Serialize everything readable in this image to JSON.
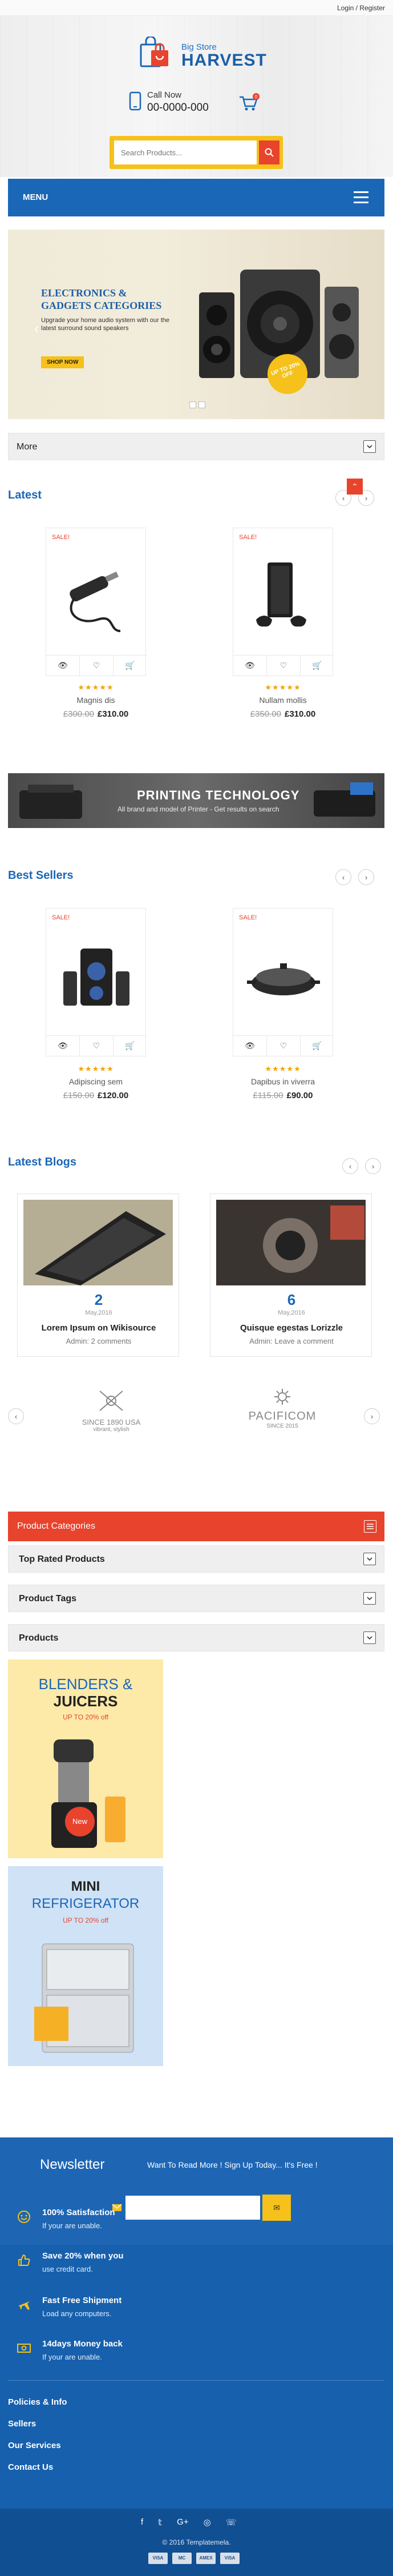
{
  "topbar": {
    "login": "Login / Register"
  },
  "header": {
    "brand_small": "Big Store",
    "brand_big": "HARVEST",
    "call_label": "Call Now",
    "phone": "00-0000-000",
    "cart_count": "0",
    "search_placeholder": "Search Products..."
  },
  "menu": {
    "label": "MENU"
  },
  "slider": {
    "title_line1": "ELECTRONICS &",
    "title_line2": "GADGETS CATEGORIES",
    "text": "Upgrade your home audio system with our the latest surround sound speakers",
    "button": "SHOP NOW",
    "badge": "UP TO 20% OFF"
  },
  "more": {
    "label": "More"
  },
  "latest": {
    "title": "Latest",
    "products": [
      {
        "sale": "SALE!",
        "name": "Magnis dis",
        "old": "£300.00",
        "price": "£310.00",
        "stars": "★★★★★"
      },
      {
        "sale": "SALE!",
        "name": "Nullam mollis",
        "old": "£350.00",
        "price": "£310.00",
        "stars": "★★★★★"
      }
    ]
  },
  "print_banner": {
    "title": "PRINTING TECHNOLOGY",
    "subtitle": "All brand and model of Printer - Get results on search"
  },
  "bestsellers": {
    "title": "Best Sellers",
    "products": [
      {
        "sale": "SALE!",
        "name": "Adipiscing sem",
        "old": "£150.00",
        "price": "£120.00",
        "stars": "★★★★★"
      },
      {
        "sale": "SALE!",
        "name": "Dapibus in viverra",
        "old": "£115.00",
        "price": "£90.00",
        "stars": "★★★★★"
      }
    ]
  },
  "blogs": {
    "title": "Latest Blogs",
    "posts": [
      {
        "day": "2",
        "month": "May,2016",
        "title": "Lorem Ipsum on Wikisource",
        "meta": "Admin: 2 comments"
      },
      {
        "day": "6",
        "month": "May,2016",
        "title": "Quisque egestas Lorizzle",
        "meta": "Admin: Leave a comment"
      }
    ]
  },
  "brands": [
    {
      "name": "SINCE 1890 USA",
      "sub": "vibrant, stylish"
    },
    {
      "name": "PACIFICOM",
      "sub": "SINCE 2015"
    }
  ],
  "sidebar": {
    "categories": "Product Categories",
    "top_rated": "Top Rated Products",
    "tags": "Product Tags",
    "products": "Products"
  },
  "promos": [
    {
      "title1": "BLENDERS &",
      "title2": "JUICERS",
      "sub": "UP TO 20% off",
      "tag": "New"
    },
    {
      "title1": "MINI",
      "title2": "REFRIGERATOR",
      "sub": "UP TO 20% off"
    }
  ],
  "newsletter": {
    "title": "Newsletter",
    "text": "Want To Read More ! Sign Up Today... It's Free !"
  },
  "features": [
    {
      "title": "100% Satisfaction",
      "sub": "If your are unable."
    },
    {
      "title": "Save 20% when you",
      "sub": "use credit card."
    },
    {
      "title": "Fast Free Shipment",
      "sub": "Load any computers."
    },
    {
      "title": "14days Money back",
      "sub": "If your are unable."
    }
  ],
  "footer_links": [
    "Policies & Info",
    "Sellers",
    "Our Services",
    "Contact Us"
  ],
  "copyright": "© 2016 Templatemela.",
  "payments": [
    "VISA",
    "MC",
    "AMEX",
    "VISA"
  ],
  "colors": {
    "blue": "#1b67b7",
    "red": "#e8432c",
    "yellow": "#f5c11a"
  }
}
